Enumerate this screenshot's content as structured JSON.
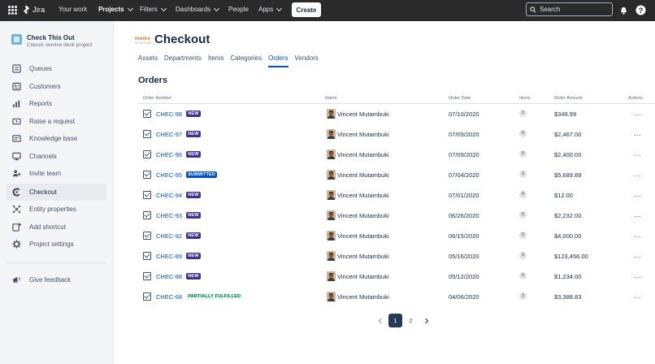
{
  "topnav": {
    "logo_text": "Jira",
    "nav": [
      {
        "label": "Your work"
      },
      {
        "label": "Projects"
      },
      {
        "label": "Filters"
      },
      {
        "label": "Dashboards"
      },
      {
        "label": "People"
      },
      {
        "label": "Apps"
      }
    ],
    "create_label": "Create",
    "search_placeholder": "Search"
  },
  "sidebar": {
    "project_name": "Check This Out",
    "project_type": "Classic service desk project",
    "items": [
      {
        "label": "Queues",
        "icon": "queues-icon"
      },
      {
        "label": "Customers",
        "icon": "customers-icon"
      },
      {
        "label": "Reports",
        "icon": "reports-icon"
      },
      {
        "label": "Raise a request",
        "icon": "raise-request-icon"
      },
      {
        "label": "Knowledge base",
        "icon": "knowledge-base-icon"
      },
      {
        "label": "Channels",
        "icon": "channels-icon"
      },
      {
        "label": "Invite team",
        "icon": "invite-team-icon"
      },
      {
        "label": "Checkout",
        "icon": "checkout-app-icon",
        "active": true
      },
      {
        "label": "Entity properties",
        "icon": "entity-properties-icon"
      },
      {
        "label": "Add shortcut",
        "icon": "add-shortcut-icon"
      },
      {
        "label": "Project settings",
        "icon": "gear-icon"
      }
    ],
    "feedback_label": "Give feedback"
  },
  "main": {
    "brand_line1": "mumo",
    "brand_line2": "SYSTEMS",
    "title": "Checkout",
    "tabs": [
      {
        "label": "Assets"
      },
      {
        "label": "Departments"
      },
      {
        "label": "Items"
      },
      {
        "label": "Categories"
      },
      {
        "label": "Orders",
        "active": true
      },
      {
        "label": "Vendors"
      }
    ],
    "section_title": "Orders",
    "columns": {
      "order_number": "Order Number",
      "name": "Name",
      "order_date": "Order Date",
      "items": "Items",
      "order_amount": "Order Amount",
      "actions": "Actions"
    },
    "rows": [
      {
        "order": "CHEC-98",
        "status": "NEW",
        "name": "Vincent Mutambuki",
        "date": "07/10/2020",
        "items": "1",
        "amount": "$349.99"
      },
      {
        "order": "CHEC-97",
        "status": "NEW",
        "name": "Vincent Mutambuki",
        "date": "07/09/2020",
        "items": "0",
        "amount": "$2,467.00"
      },
      {
        "order": "CHEC-96",
        "status": "NEW",
        "name": "Vincent Mutambuki",
        "date": "07/09/2020",
        "items": "0",
        "amount": "$2,400.00"
      },
      {
        "order": "CHEC-95",
        "status": "SUBMITTED",
        "name": "Vincent Mutambuki",
        "date": "07/04/2020",
        "items": "3",
        "amount": "$5,689.88"
      },
      {
        "order": "CHEC-94",
        "status": "NEW",
        "name": "Vincent Mutambuki",
        "date": "07/01/2020",
        "items": "0",
        "amount": "$12.00"
      },
      {
        "order": "CHEC-93",
        "status": "NEW",
        "name": "Vincent Mutambuki",
        "date": "06/26/2020",
        "items": "0",
        "amount": "$2,232.00"
      },
      {
        "order": "CHEC-92",
        "status": "NEW",
        "name": "Vincent Mutambuki",
        "date": "06/15/2020",
        "items": "0",
        "amount": "$4,000.00"
      },
      {
        "order": "CHEC-89",
        "status": "NEW",
        "name": "Vincent Mutambuki",
        "date": "05/16/2020",
        "items": "0",
        "amount": "$123,456.00"
      },
      {
        "order": "CHEC-88",
        "status": "NEW",
        "name": "Vincent Mutambuki",
        "date": "05/12/2020",
        "items": "0",
        "amount": "$1,234.00"
      },
      {
        "order": "CHEC-68",
        "status": "PARTIALLY FULFILLED",
        "name": "Vincent Mutambuki",
        "date": "04/06/2020",
        "items": "3",
        "amount": "$3,388.83"
      }
    ],
    "row_actions_label": "...",
    "pagination": {
      "pages": [
        "1",
        "2"
      ],
      "current": "1"
    }
  },
  "colors": {
    "topbar": "#2a2a2a",
    "link": "#0052cc",
    "badge_new": "#403294",
    "badge_submitted": "#0052cc",
    "badge_partial_bg": "#e3fcef",
    "badge_partial_text": "#006644"
  }
}
